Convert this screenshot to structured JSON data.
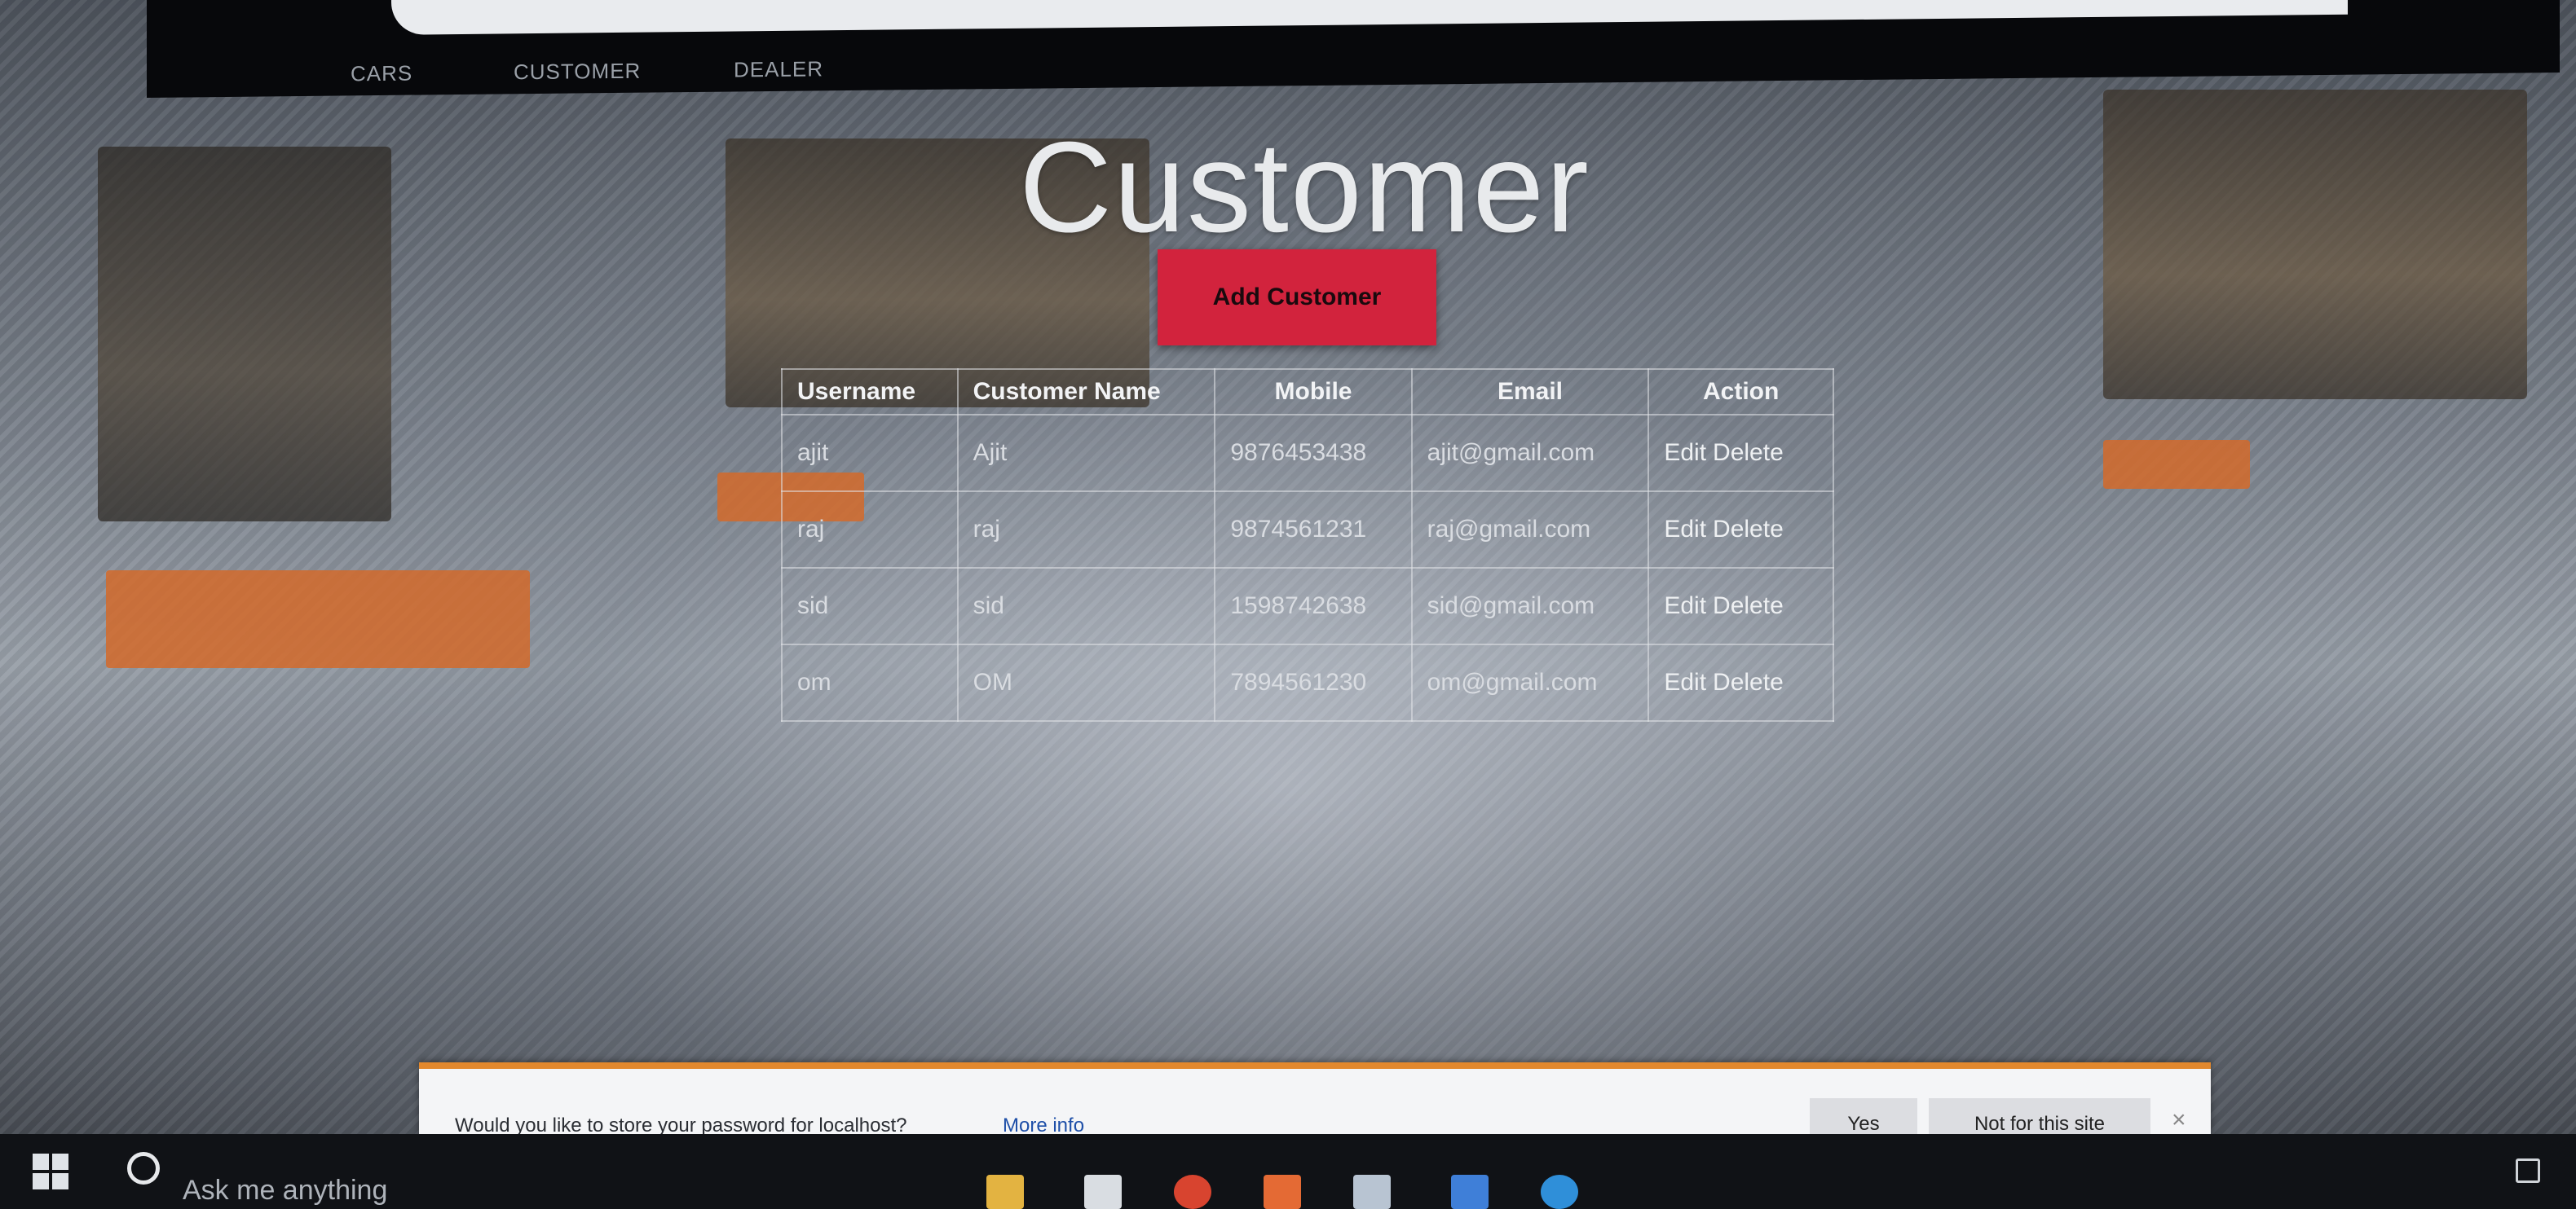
{
  "nav": {
    "links": [
      "CARS",
      "CUSTOMER",
      "DEALER"
    ]
  },
  "page": {
    "title": "Customer",
    "add_button_label": "Add Customer"
  },
  "table": {
    "headers": [
      "Username",
      "Customer Name",
      "Mobile",
      "Email",
      "Action"
    ],
    "rows": [
      {
        "username": "ajit",
        "name": "Ajit",
        "mobile": "9876453438",
        "email": "ajit@gmail.com",
        "edit": "Edit",
        "delete": "Delete"
      },
      {
        "username": "raj",
        "name": "raj",
        "mobile": "9874561231",
        "email": "raj@gmail.com",
        "edit": "Edit",
        "delete": "Delete"
      },
      {
        "username": "sid",
        "name": "sid",
        "mobile": "1598742638",
        "email": "sid@gmail.com",
        "edit": "Edit",
        "delete": "Delete"
      },
      {
        "username": "om",
        "name": "OM",
        "mobile": "7894561230",
        "email": "om@gmail.com",
        "edit": "Edit",
        "delete": "Delete"
      }
    ]
  },
  "password_prompt": {
    "message": "Would you like to store your password for localhost?",
    "more_info": "More info",
    "yes_label": "Yes",
    "no_label": "Not for this site",
    "close_symbol": "×"
  },
  "taskbar": {
    "search_placeholder": "Ask me anything"
  },
  "colors": {
    "add_button": "#d2233d",
    "prompt_accent": "#e2882d",
    "taskbar": "#101216"
  },
  "icons": [
    "windows-start-icon",
    "cortana-icon",
    "file-explorer-icon",
    "store-icon",
    "chrome-icon",
    "app-icon",
    "app-icon",
    "app-icon",
    "edge-icon",
    "notification-icon"
  ]
}
